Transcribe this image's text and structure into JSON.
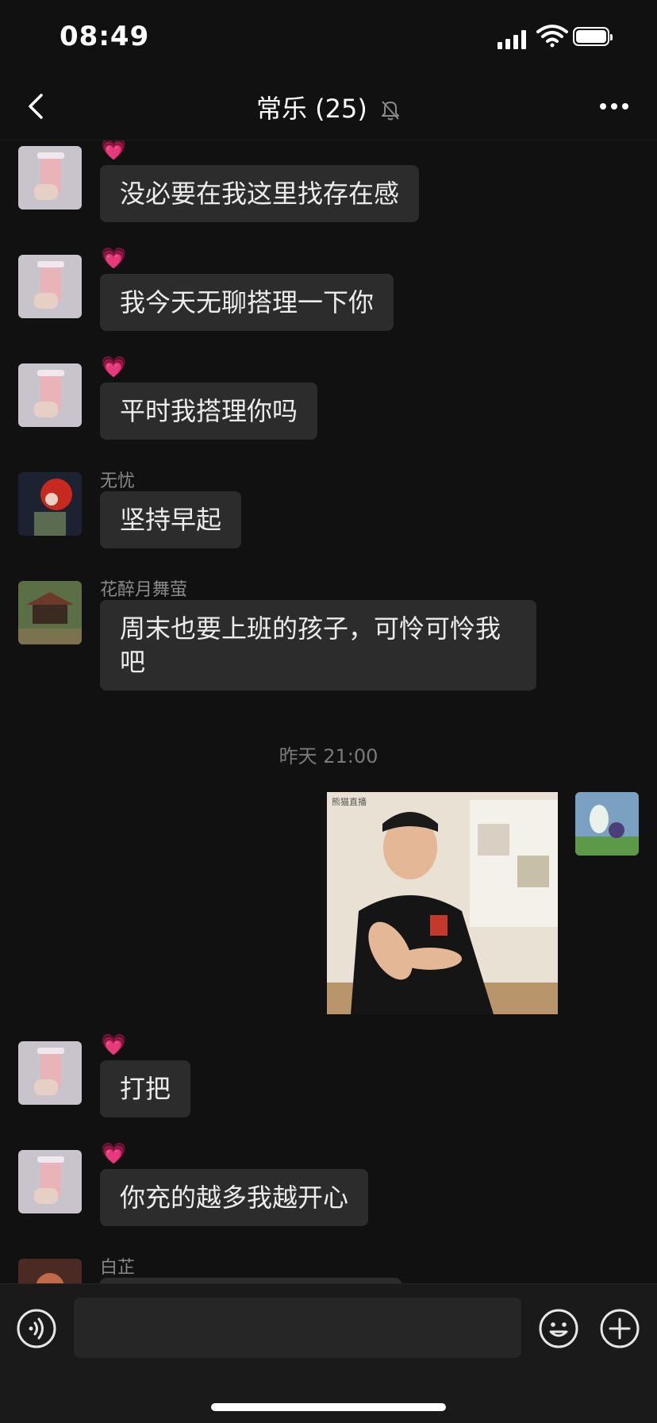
{
  "status_bar": {
    "time": "08:49"
  },
  "header": {
    "title": "常乐 (25)",
    "muted": true
  },
  "messages": [
    {
      "badge": "💗",
      "text": "没必要在我这里找存在感"
    },
    {
      "badge": "💗",
      "text": "我今天无聊搭理一下你"
    },
    {
      "badge": "💗",
      "text": "平时我搭理你吗"
    },
    {
      "sender": "无忧",
      "text": "坚持早起"
    },
    {
      "sender": "花醉月舞萤",
      "text": "周末也要上班的孩子，可怜可怜我吧"
    },
    {
      "badge": "💗",
      "text": "打把"
    },
    {
      "badge": "💗",
      "text": "你充的越多我越开心"
    },
    {
      "sender": "白芷",
      "text": ""
    }
  ],
  "timestamp": "昨天 21:00",
  "image_message": {
    "watermark": "熊猫直播"
  },
  "input_bar": {
    "placeholder": ""
  },
  "colors": {
    "background": "#111111",
    "bubble": "#2c2c2c",
    "text": "#ececec",
    "muted_text": "#8a8a8a"
  }
}
